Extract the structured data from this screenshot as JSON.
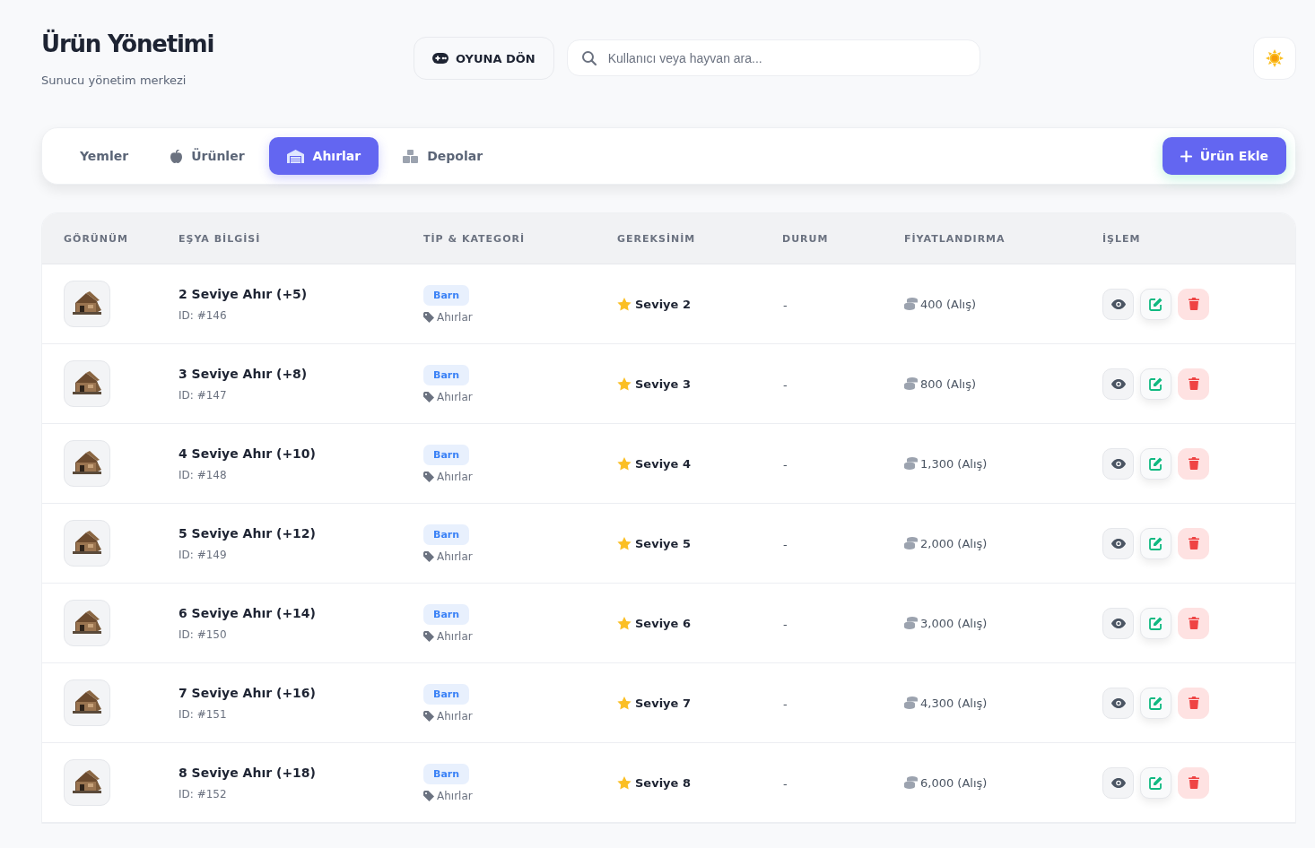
{
  "header": {
    "title": "Ürün Yönetimi",
    "subtitle": "Sunucu yönetim merkezi",
    "game_button": "OYUNA DÖN",
    "search": {
      "placeholder": "Kullanıcı veya hayvan ara..."
    }
  },
  "tabs": [
    {
      "label": "Yemler",
      "selected": false,
      "kind": "plain"
    },
    {
      "label": "Ürünler",
      "selected": false,
      "kind": "apple"
    },
    {
      "label": "Ahırlar",
      "selected": true,
      "kind": "warehouse"
    },
    {
      "label": "Depolar",
      "selected": false,
      "kind": "boxes"
    }
  ],
  "add_button": "Ürün Ekle",
  "table": {
    "columns": [
      "GÖRÜNÜM",
      "EŞYA BİLGİSİ",
      "TİP & KATEGORİ",
      "GEREKSİNİM",
      "DURUM",
      "FİYATLANDIRMA",
      "İŞLEM"
    ],
    "rows": [
      {
        "name": "2 Seviye Ahır (+5)",
        "id": "ID: #146",
        "type": "Barn",
        "category": "Ahırlar",
        "requirement": "Seviye 2",
        "status": "-",
        "price": "400 (Alış)"
      },
      {
        "name": "3 Seviye Ahır (+8)",
        "id": "ID: #147",
        "type": "Barn",
        "category": "Ahırlar",
        "requirement": "Seviye 3",
        "status": "-",
        "price": "800 (Alış)"
      },
      {
        "name": "4 Seviye Ahır (+10)",
        "id": "ID: #148",
        "type": "Barn",
        "category": "Ahırlar",
        "requirement": "Seviye 4",
        "status": "-",
        "price": "1,300 (Alış)"
      },
      {
        "name": "5 Seviye Ahır (+12)",
        "id": "ID: #149",
        "type": "Barn",
        "category": "Ahırlar",
        "requirement": "Seviye 5",
        "status": "-",
        "price": "2,000 (Alış)"
      },
      {
        "name": "6 Seviye Ahır (+14)",
        "id": "ID: #150",
        "type": "Barn",
        "category": "Ahırlar",
        "requirement": "Seviye 6",
        "status": "-",
        "price": "3,000 (Alış)"
      },
      {
        "name": "7 Seviye Ahır (+16)",
        "id": "ID: #151",
        "type": "Barn",
        "category": "Ahırlar",
        "requirement": "Seviye 7",
        "status": "-",
        "price": "4,300 (Alış)"
      },
      {
        "name": "8 Seviye Ahır (+18)",
        "id": "ID: #152",
        "type": "Barn",
        "category": "Ahırlar",
        "requirement": "Seviye 8",
        "status": "-",
        "price": "6,000 (Alış)"
      }
    ]
  }
}
